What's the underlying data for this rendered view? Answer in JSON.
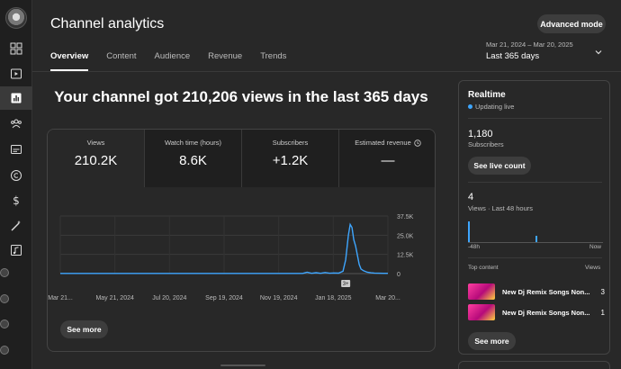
{
  "page": {
    "title": "Channel analytics",
    "advanced_mode_label": "Advanced mode",
    "tabs": [
      {
        "label": "Overview",
        "active": true
      },
      {
        "label": "Content",
        "active": false
      },
      {
        "label": "Audience",
        "active": false
      },
      {
        "label": "Revenue",
        "active": false
      },
      {
        "label": "Trends",
        "active": false
      }
    ],
    "date_range": "Mar 21, 2024 – Mar 20, 2025",
    "date_preset": "Last 365 days"
  },
  "rail": {
    "icons": [
      "dashboard-icon",
      "content-icon",
      "analytics-icon",
      "community-icon",
      "subtitles-icon",
      "copyright-icon",
      "earn-icon",
      "customization-icon",
      "audio-library-icon"
    ],
    "active": "analytics-icon"
  },
  "overview": {
    "headline": "Your channel got 210,206 views in the last 365 days",
    "metrics": [
      {
        "label": "Views",
        "value": "210.2K",
        "selected": true
      },
      {
        "label": "Watch time (hours)",
        "value": "8.6K",
        "selected": false
      },
      {
        "label": "Subscribers",
        "value": "+1.2K",
        "selected": false
      },
      {
        "label": "Estimated revenue",
        "value": "—",
        "selected": false,
        "info": true
      }
    ],
    "see_more_label": "See more"
  },
  "chart_data": {
    "type": "line",
    "x_ticks": [
      "Mar 21...",
      "May 21, 2024",
      "Jul 20, 2024",
      "Sep 19, 2024",
      "Nov 19, 2024",
      "Jan 18, 2025",
      "Mar 20..."
    ],
    "y_ticks": [
      "37.5K",
      "25.0K",
      "12.5K",
      "0"
    ],
    "ylim": [
      0,
      37500
    ],
    "marker_label": "3+",
    "color": "#3ea6ff",
    "series": [
      {
        "points": [
          [
            0,
            120
          ],
          [
            10,
            100
          ],
          [
            20,
            110
          ],
          [
            30,
            90
          ],
          [
            40,
            120
          ],
          [
            50,
            100
          ],
          [
            60,
            95
          ],
          [
            70,
            110
          ],
          [
            80,
            100
          ],
          [
            90,
            120
          ],
          [
            100,
            105
          ],
          [
            110,
            100
          ],
          [
            120,
            115
          ],
          [
            130,
            110
          ],
          [
            140,
            100
          ],
          [
            150,
            120
          ],
          [
            160,
            110
          ],
          [
            170,
            105
          ],
          [
            180,
            120
          ],
          [
            190,
            110
          ],
          [
            200,
            100
          ],
          [
            210,
            115
          ],
          [
            220,
            120
          ],
          [
            230,
            110
          ],
          [
            240,
            105
          ],
          [
            250,
            120
          ],
          [
            260,
            110
          ],
          [
            270,
            130
          ],
          [
            275,
            900
          ],
          [
            280,
            150
          ],
          [
            285,
            600
          ],
          [
            290,
            200
          ],
          [
            295,
            700
          ],
          [
            300,
            250
          ],
          [
            305,
            400
          ],
          [
            310,
            300
          ],
          [
            315,
            1500
          ],
          [
            318,
            9000
          ],
          [
            321,
            25000
          ],
          [
            323,
            32000
          ],
          [
            325,
            30000
          ],
          [
            327,
            22000
          ],
          [
            329,
            18000
          ],
          [
            331,
            12000
          ],
          [
            333,
            6000
          ],
          [
            335,
            3000
          ],
          [
            338,
            1800
          ],
          [
            342,
            900
          ],
          [
            346,
            500
          ],
          [
            350,
            350
          ],
          [
            355,
            250
          ],
          [
            360,
            200
          ],
          [
            365,
            180
          ]
        ],
        "x_max": 365
      }
    ]
  },
  "realtime": {
    "title": "Realtime",
    "status": "Updating live",
    "subscribers_value": "1,180",
    "subscribers_label": "Subscribers",
    "live_count_label": "See live count",
    "views_value": "4",
    "views_label": "Views · Last 48 hours",
    "axis_left": "-48h",
    "axis_right": "Now",
    "bars": [
      {
        "hour": 0,
        "views": 3
      },
      {
        "hour": 24,
        "views": 1
      }
    ],
    "top_content_label": "Top content",
    "top_content_col": "Views",
    "top_content": [
      {
        "title": "New Dj Remix Songs Non...",
        "views": "3"
      },
      {
        "title": "New Dj Remix Songs Non...",
        "views": "1"
      }
    ],
    "see_more_label": "See more"
  }
}
